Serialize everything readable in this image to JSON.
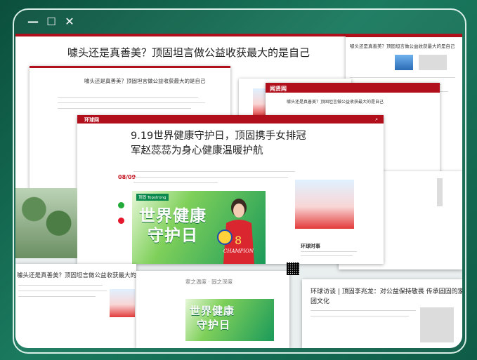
{
  "window": {
    "controls": {
      "minimize": "—",
      "maximize": "☐",
      "close": "✕"
    }
  },
  "articles": {
    "back_title": "噱头还是真善美？顶固坦言做公益收获最大的是自己",
    "mid_title_small": "噱头还是真善美？顶固坦言做公益收获最大的是自己",
    "right_title": "噱头还是真善美？顶固坦言做公益收获最大的是自己",
    "bottom_left_title": "噱头还是真善美？顶固坦言做公益收获最大的是自己",
    "main_title": "9.19世界健康守护日，顶固携手女排冠军赵蕊蕊为身心健康温暖护航",
    "main_date": "08/09",
    "main_logo": "环球网",
    "right_logo": "闻贤网",
    "bottom_right_title": "环球访谈 | 顶固李兆龙：对公益保持敬畏 传承固固的家文化",
    "bottom_right_sub": "团文化",
    "hero_line1": "世界健康",
    "hero_line2": "守护日",
    "hero_brand": "顶固 Topstrong",
    "hero_tag": "CHAMPION",
    "bottom_mid_slogan": "家之温度 · 固之深度",
    "sidebar_heading": "环球时事"
  },
  "colors": {
    "brand_red": "#b10f1c",
    "frame_green": "#0e5b46",
    "hero_green": "#1b9a5a"
  }
}
